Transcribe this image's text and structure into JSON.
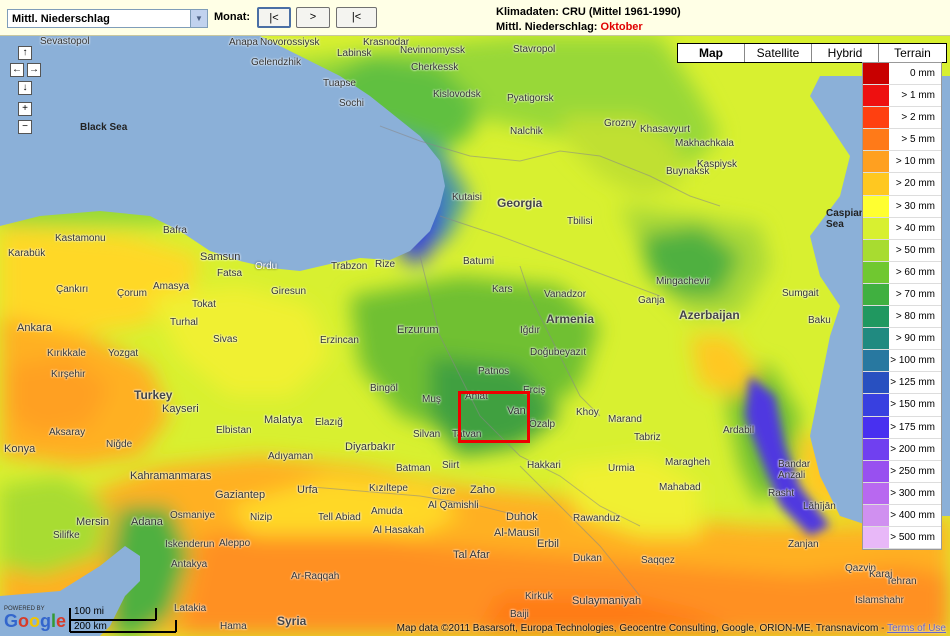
{
  "toolbar": {
    "parameter_value": "Mittl. Niederschlag",
    "month_label": "Monat:",
    "prev_label": "|<",
    "next_label": ">",
    "first_label": "|<"
  },
  "info": {
    "line1": "Klimadaten: CRU (Mittel 1961-1990)",
    "line2_prefix": "Mittl. Niederschlag:",
    "line2_month": "Oktober"
  },
  "map_types": [
    "Map",
    "Satellite",
    "Hybrid",
    "Terrain"
  ],
  "legend": [
    {
      "label": "0 mm",
      "color": "#c80000"
    },
    {
      "label": "> 1 mm",
      "color": "#ee1010"
    },
    {
      "label": "> 2 mm",
      "color": "#ff4010"
    },
    {
      "label": "> 5 mm",
      "color": "#ff7a18"
    },
    {
      "label": "> 10 mm",
      "color": "#ffa020"
    },
    {
      "label": "> 20 mm",
      "color": "#ffc820"
    },
    {
      "label": "> 30 mm",
      "color": "#ffff30"
    },
    {
      "label": "> 40 mm",
      "color": "#d8f030"
    },
    {
      "label": "> 50 mm",
      "color": "#a8dc30"
    },
    {
      "label": "> 60 mm",
      "color": "#70c830"
    },
    {
      "label": "> 70 mm",
      "color": "#40b040"
    },
    {
      "label": "> 80 mm",
      "color": "#209860"
    },
    {
      "label": "> 90 mm",
      "color": "#208a80"
    },
    {
      "label": "> 100 mm",
      "color": "#2878a0"
    },
    {
      "label": "> 125 mm",
      "color": "#2850c0"
    },
    {
      "label": "> 150 mm",
      "color": "#3840e0"
    },
    {
      "label": "> 175 mm",
      "color": "#4830f0"
    },
    {
      "label": "> 200 mm",
      "color": "#7040f0"
    },
    {
      "label": "> 250 mm",
      "color": "#9850f0"
    },
    {
      "label": "> 300 mm",
      "color": "#b868f0"
    },
    {
      "label": "> 400 mm",
      "color": "#d090f0"
    },
    {
      "label": "> 500 mm",
      "color": "#e8b8f8"
    }
  ],
  "places": [
    {
      "name": "Sevastopol"
    },
    {
      "name": "Anapa"
    },
    {
      "name": "Novorossiysk"
    },
    {
      "name": "Krasnodar"
    },
    {
      "name": "Labinsk"
    },
    {
      "name": "Nevinnomyssk"
    },
    {
      "name": "Stavropol"
    },
    {
      "name": "Gelendzhik"
    },
    {
      "name": "Cherkessk"
    },
    {
      "name": "Kislovodsk"
    },
    {
      "name": "Tuapse"
    },
    {
      "name": "Pyatigorsk"
    },
    {
      "name": "Sochi"
    },
    {
      "name": "Nalchik"
    },
    {
      "name": "Grozny"
    },
    {
      "name": "Khasavyurt"
    },
    {
      "name": "Makhachkala"
    },
    {
      "name": "Buynaksk"
    },
    {
      "name": "Kaspiysk"
    },
    {
      "name": "Kutaisi"
    },
    {
      "name": "Tbilisi"
    },
    {
      "name": "Bafra"
    },
    {
      "name": "Kastamonu"
    },
    {
      "name": "Samsun"
    },
    {
      "name": "Ordu"
    },
    {
      "name": "Trabzon"
    },
    {
      "name": "Rize"
    },
    {
      "name": "Fatsa"
    },
    {
      "name": "Giresun"
    },
    {
      "name": "Batumi"
    },
    {
      "name": "Karabük"
    },
    {
      "name": "Çankırı"
    },
    {
      "name": "Çorum"
    },
    {
      "name": "Amasya"
    },
    {
      "name": "Tokat"
    },
    {
      "name": "Turhal"
    },
    {
      "name": "Kars"
    },
    {
      "name": "Vanadzor"
    },
    {
      "name": "Ganja"
    },
    {
      "name": "Mingachevir"
    },
    {
      "name": "Sumgait"
    },
    {
      "name": "Baku"
    },
    {
      "name": "Ankara"
    },
    {
      "name": "Sivas"
    },
    {
      "name": "Erzurum"
    },
    {
      "name": "Erzincan"
    },
    {
      "name": "Iğdır"
    },
    {
      "name": "Doğubeyazıt"
    },
    {
      "name": "Kırıkkale"
    },
    {
      "name": "Yozgat"
    },
    {
      "name": "Kırşehir"
    },
    {
      "name": "Bingöl"
    },
    {
      "name": "Muş"
    },
    {
      "name": "Patnos"
    },
    {
      "name": "Ahlat"
    },
    {
      "name": "Van"
    },
    {
      "name": "Erciş"
    },
    {
      "name": "Özalp"
    },
    {
      "name": "Khoy"
    },
    {
      "name": "Marand"
    },
    {
      "name": "Tabriz"
    },
    {
      "name": "Ardabil"
    },
    {
      "name": "Kayseri"
    },
    {
      "name": "Aksaray"
    },
    {
      "name": "Niğde"
    },
    {
      "name": "Malatya"
    },
    {
      "name": "Elazığ"
    },
    {
      "name": "Elbistan"
    },
    {
      "name": "Silvan"
    },
    {
      "name": "Tatvan"
    },
    {
      "name": "Diyarbakır"
    },
    {
      "name": "Batman"
    },
    {
      "name": "Siirt"
    },
    {
      "name": "Hakkari"
    },
    {
      "name": "Urmia"
    },
    {
      "name": "Maragheh"
    },
    {
      "name": "Mahabad"
    },
    {
      "name": "Bandar Anzali"
    },
    {
      "name": "Rasht"
    },
    {
      "name": "Lāhījān"
    },
    {
      "name": "Konya"
    },
    {
      "name": "Kahramanmaras"
    },
    {
      "name": "Adıyaman"
    },
    {
      "name": "Gaziantep"
    },
    {
      "name": "Urfa"
    },
    {
      "name": "Kızıltepe"
    },
    {
      "name": "Cizre"
    },
    {
      "name": "Zaho"
    },
    {
      "name": "Duhok"
    },
    {
      "name": "Amuda"
    },
    {
      "name": "Al Qamishli"
    },
    {
      "name": "Rawanduz"
    },
    {
      "name": "Mersin"
    },
    {
      "name": "Adana"
    },
    {
      "name": "Osmaniye"
    },
    {
      "name": "Nizip"
    },
    {
      "name": "Tell Abiad"
    },
    {
      "name": "Al Hasakah"
    },
    {
      "name": "Al-Mausil"
    },
    {
      "name": "Erbil"
    },
    {
      "name": "Silifke"
    },
    {
      "name": "Iskenderun"
    },
    {
      "name": "Antakya"
    },
    {
      "name": "Aleppo"
    },
    {
      "name": "Ar-Raqqah"
    },
    {
      "name": "Tal Afar"
    },
    {
      "name": "Dukan"
    },
    {
      "name": "Saqqez"
    },
    {
      "name": "Sulaymaniyah"
    },
    {
      "name": "Kirkuk"
    },
    {
      "name": "Zanjan"
    },
    {
      "name": "Qazvin"
    },
    {
      "name": "Tehran"
    },
    {
      "name": "Karaj"
    },
    {
      "name": "Latakia"
    },
    {
      "name": "Hama"
    },
    {
      "name": "Baiji"
    },
    {
      "name": "Islamshahr"
    }
  ],
  "regions": [
    {
      "name": "Black Sea"
    },
    {
      "name": "Georgia"
    },
    {
      "name": "Armenia"
    },
    {
      "name": "Azerbaijan"
    },
    {
      "name": "Turkey"
    },
    {
      "name": "Syria"
    },
    {
      "name": "Caspian Sea"
    }
  ],
  "scale": {
    "miles": "100 mi",
    "km": "200 km"
  },
  "powered_by": "POWERED BY",
  "google": "Google",
  "footer": {
    "attribution": "Map data ©2011 Basarsoft, Europa Technologies, Geocentre Consulting, Google, ORION-ME, Transnavicom -",
    "terms": "Terms of Use"
  }
}
